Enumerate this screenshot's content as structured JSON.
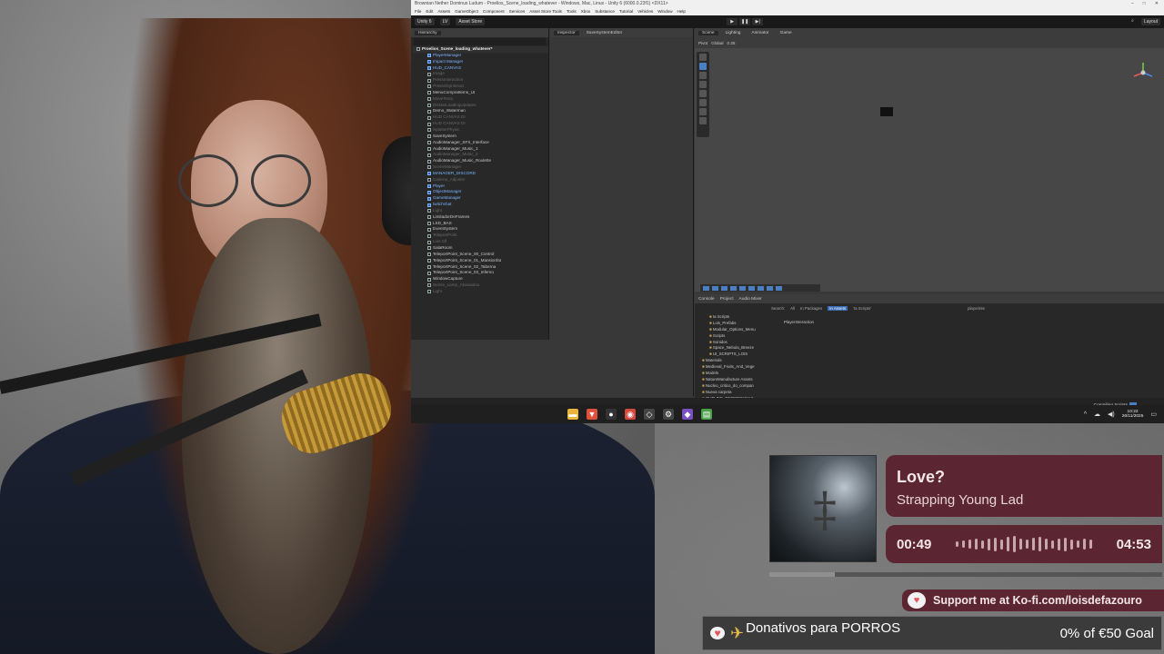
{
  "unity": {
    "window_title": "Brownian Nether Dominus Ludum - Proelios_Scene_loading_whatever - Windows, Mac, Linux - Unity 6 (6000.0.23f1) <DX11>",
    "menu": [
      "File",
      "Edit",
      "Assets",
      "GameObject",
      "Component",
      "Services",
      "Asset Store Tools",
      "Tools",
      "Xbox",
      "Substance",
      "Tutorial",
      "Vehicles",
      "Window",
      "Help"
    ],
    "toolbar": {
      "account": "Unity 6",
      "lock": "LV",
      "asset_store": "Asset Store",
      "layout": "Layout"
    },
    "panels": {
      "hierarchy_tab": "Hierarchy",
      "inspector_tab": "Inspector",
      "save_editor_tab": "SaveSystemEditor",
      "scene_tab": "Scene",
      "lighting_tab": "Lighting",
      "animator_tab": "Animator",
      "game_tab": "Game",
      "console_tab": "Console",
      "project_tab": "Project",
      "audio_mixer_tab": "Audio Mixer"
    },
    "scene_toolbar": {
      "pivot": "Pivot",
      "global": "Global",
      "snap": "0.25"
    },
    "hierarchy": [
      {
        "label": "Proelios_Scene_loading_whatever*",
        "style": "scene"
      },
      {
        "label": "PlayerManager",
        "style": "blue"
      },
      {
        "label": "Impact Manager",
        "style": "blue"
      },
      {
        "label": "HUD_CANVAS",
        "style": "blue"
      },
      {
        "label": "Image",
        "style": "dim"
      },
      {
        "label": "PressInteraction",
        "style": "dim"
      },
      {
        "label": "PressObjInteract",
        "style": "dim"
      },
      {
        "label": "MenuCompraItems_UI",
        "style": "normal"
      },
      {
        "label": "MoveTexto",
        "style": "dim"
      },
      {
        "label": "DisNarLoadingUpdates",
        "style": "dim"
      },
      {
        "label": "Demo_Waterman",
        "style": "normal"
      },
      {
        "label": "HUD CANVAS DI",
        "style": "dim"
      },
      {
        "label": "HUD CANVAS DI",
        "style": "dim"
      },
      {
        "label": "SplatterPhysic",
        "style": "dim"
      },
      {
        "label": "SaveSystem",
        "style": "normal"
      },
      {
        "label": "AudioManager_SFX_Interface",
        "style": "normal"
      },
      {
        "label": "AudioManager_Music_1",
        "style": "normal"
      },
      {
        "label": "AudioManager_Music_2",
        "style": "dim"
      },
      {
        "label": "AudioManager_Music_Roulette",
        "style": "normal"
      },
      {
        "label": "SceneManager",
        "style": "dim"
      },
      {
        "label": "MANAGER_DISCORD",
        "style": "blue"
      },
      {
        "label": "Cadena_Adjuster",
        "style": "dim"
      },
      {
        "label": "Player",
        "style": "blue"
      },
      {
        "label": "ObjectManager",
        "style": "blue"
      },
      {
        "label": "GameManager",
        "style": "blue"
      },
      {
        "label": "twitchchat",
        "style": "blue"
      },
      {
        "label": "Light",
        "style": "dim"
      },
      {
        "label": "LimitadorDeFrames",
        "style": "normal"
      },
      {
        "label": "LSD_BAS",
        "style": "normal"
      },
      {
        "label": "EventSystem",
        "style": "normal"
      },
      {
        "label": "TelaporiPoint",
        "style": "dim"
      },
      {
        "label": "Luis Cll",
        "style": "dim"
      },
      {
        "label": "SalaRoom",
        "style": "normal"
      },
      {
        "label": "TeleportPoint_Scene_00_Control",
        "style": "normal"
      },
      {
        "label": "TeleportPoint_Scene_01_Mansionfat",
        "style": "normal"
      },
      {
        "label": "TeleportPoint_Scene_02_Taberna",
        "style": "normal"
      },
      {
        "label": "TeleportPoint_Scene_03_Inferno",
        "style": "normal"
      },
      {
        "label": "WindowCapture",
        "style": "normal"
      },
      {
        "label": "Scene_Lamp_Abaixadoo",
        "style": "dim"
      },
      {
        "label": "Light",
        "style": "dim"
      }
    ],
    "project": {
      "search_label": "Search:",
      "scopes": [
        "All",
        "In Packages",
        "In Assets",
        "'Ia Scripts'"
      ],
      "search_query": "playerinte",
      "result": "PlayerInteraction",
      "folders": [
        "Ia Scripts",
        "Lois_Prefabs",
        "Modular_Options_Menu",
        "Scripts",
        "Sonidos",
        "Space_Nebula_Breeze",
        "UI_SCRIPTS_LOIS",
        "Materials",
        "Medieval_Fruits_And_Vege",
        "Models",
        "NatureManufacture Assets",
        "Nucleo_critico_do_compan",
        "Nueva carpeta",
        "OUTLINE_REFERENCIAS"
      ]
    },
    "status": {
      "compiling": "Compiling Scripts"
    }
  },
  "taskbar": {
    "time": "10:22",
    "date": "26/11/2025",
    "apps": [
      {
        "icon": "folder-icon",
        "color": "#e8b43c",
        "glyph": "▬"
      },
      {
        "icon": "brave-icon",
        "color": "#e0503a",
        "glyph": "▼"
      },
      {
        "icon": "obs-icon",
        "color": "#333333",
        "glyph": "●"
      },
      {
        "icon": "chrome-icon",
        "color": "#d6473e",
        "glyph": "◉"
      },
      {
        "icon": "unity-icon",
        "color": "#444444",
        "glyph": "◇"
      },
      {
        "icon": "settings-icon",
        "color": "#444444",
        "glyph": "⚙"
      },
      {
        "icon": "visual-studio-icon",
        "color": "#7b4fc2",
        "glyph": "◆"
      },
      {
        "icon": "notepad-icon",
        "color": "#4aa04a",
        "glyph": "▤"
      }
    ]
  },
  "now_playing": {
    "title": "Love?",
    "artist": "Strapping Young Lad",
    "elapsed": "00:49",
    "duration": "04:53",
    "progress_fraction": 0.167
  },
  "kofi": {
    "text": "Support me at Ko-fi.com/loisdefazouro"
  },
  "goal": {
    "label": "Donativos para PORROS",
    "status": "0% of €50 Goal"
  },
  "colors": {
    "widget_bg": "#5b2632",
    "unity_dark": "#282828",
    "accent_blue": "#4a7fc4"
  }
}
